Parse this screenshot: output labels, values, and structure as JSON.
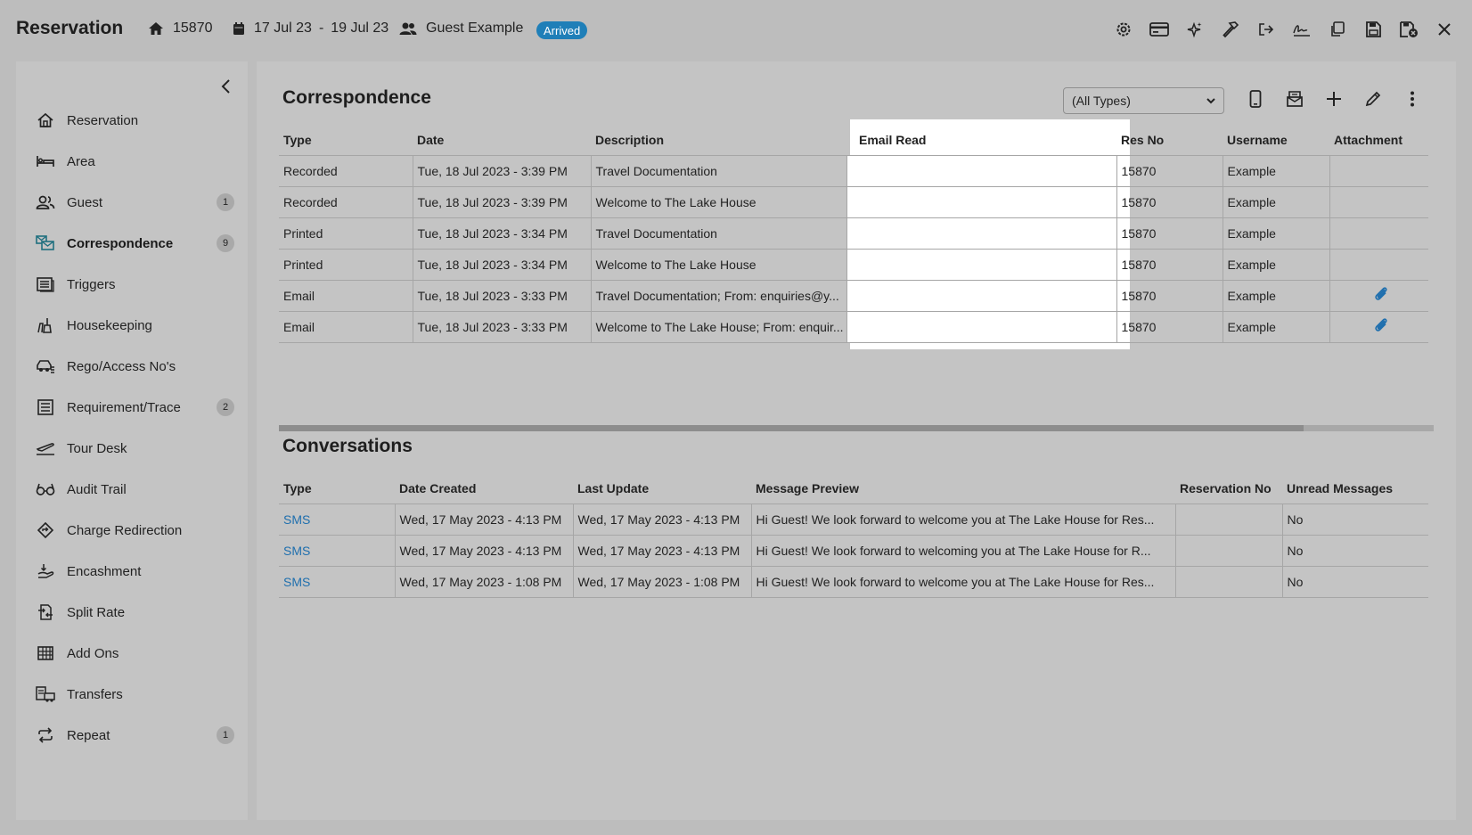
{
  "header": {
    "title": "Reservation",
    "res_no": "15870",
    "date_from": "17 Jul 23",
    "date_sep": "-",
    "date_to": "19 Jul 23",
    "guest": "Guest Example",
    "status": "Arrived",
    "status_color": "#1f7fb8",
    "icons": [
      "gear-icon",
      "card-icon",
      "stars-icon",
      "hammer-icon",
      "checkout-icon",
      "signature-icon",
      "copy-icon",
      "save-icon",
      "save-close-icon",
      "close-icon"
    ]
  },
  "sidebar": {
    "items": [
      {
        "label": "Reservation",
        "icon": "house-icon",
        "count": ""
      },
      {
        "label": "Area",
        "icon": "bed-icon",
        "count": ""
      },
      {
        "label": "Guest",
        "icon": "guest-icon",
        "count": "1"
      },
      {
        "label": "Correspondence",
        "icon": "correspondence-icon",
        "count": "9"
      },
      {
        "label": "Triggers",
        "icon": "triggers-icon",
        "count": ""
      },
      {
        "label": "Housekeeping",
        "icon": "housekeeping-icon",
        "count": ""
      },
      {
        "label": "Rego/Access No's",
        "icon": "car-icon",
        "count": ""
      },
      {
        "label": "Requirement/Trace",
        "icon": "list-icon",
        "count": "2"
      },
      {
        "label": "Tour Desk",
        "icon": "plane-icon",
        "count": ""
      },
      {
        "label": "Audit Trail",
        "icon": "glasses-icon",
        "count": ""
      },
      {
        "label": "Charge Redirection",
        "icon": "redirect-icon",
        "count": ""
      },
      {
        "label": "Encashment",
        "icon": "encash-icon",
        "count": ""
      },
      {
        "label": "Split Rate",
        "icon": "split-icon",
        "count": ""
      },
      {
        "label": "Add Ons",
        "icon": "grid-icon",
        "count": ""
      },
      {
        "label": "Transfers",
        "icon": "bus-icon",
        "count": ""
      },
      {
        "label": "Repeat",
        "icon": "repeat-icon",
        "count": "1"
      }
    ]
  },
  "correspondence": {
    "title": "Correspondence",
    "filter_value": "(All Types)",
    "columns": [
      "Type",
      "Date",
      "Description",
      "Email Read",
      "Res No",
      "Username",
      "Attachment"
    ],
    "rows": [
      {
        "type": "Recorded",
        "date": "Tue, 18 Jul 2023 - 3:39 PM",
        "description": "Travel Documentation",
        "email_read": "",
        "res_no": "15870",
        "username": "Example",
        "attachment": false
      },
      {
        "type": "Recorded",
        "date": "Tue, 18 Jul 2023 - 3:39 PM",
        "description": "Welcome to The Lake House",
        "email_read": "",
        "res_no": "15870",
        "username": "Example",
        "attachment": false
      },
      {
        "type": "Printed",
        "date": "Tue, 18 Jul 2023 - 3:34 PM",
        "description": "Travel Documentation",
        "email_read": "",
        "res_no": "15870",
        "username": "Example",
        "attachment": false
      },
      {
        "type": "Printed",
        "date": "Tue, 18 Jul 2023 - 3:34 PM",
        "description": "Welcome to The Lake House",
        "email_read": "",
        "res_no": "15870",
        "username": "Example",
        "attachment": false
      },
      {
        "type": "Email",
        "date": "Tue, 18 Jul 2023 - 3:33 PM",
        "description": "Travel Documentation; From: enquiries@y...",
        "email_read": "",
        "res_no": "15870",
        "username": "Example",
        "attachment": true
      },
      {
        "type": "Email",
        "date": "Tue, 18 Jul 2023 - 3:33 PM",
        "description": "Welcome to The Lake House; From: enquir...",
        "email_read": "",
        "res_no": "15870",
        "username": "Example",
        "attachment": true
      }
    ]
  },
  "conversations": {
    "title": "Conversations",
    "columns": [
      "Type",
      "Date Created",
      "Last Update",
      "Message Preview",
      "Reservation No",
      "Unread Messages"
    ],
    "rows": [
      {
        "type": "SMS",
        "created": "Wed, 17 May 2023 - 4:13 PM",
        "updated": "Wed, 17 May 2023 - 4:13 PM",
        "preview": "Hi Guest! We look forward to welcome you at The Lake House for Res...",
        "res_no": "",
        "unread": "No"
      },
      {
        "type": "SMS",
        "created": "Wed, 17 May 2023 - 4:13 PM",
        "updated": "Wed, 17 May 2023 - 4:13 PM",
        "preview": "Hi Guest! We look forward to welcoming you at The Lake House for R...",
        "res_no": "",
        "unread": "No"
      },
      {
        "type": "SMS",
        "created": "Wed, 17 May 2023 - 1:08 PM",
        "updated": "Wed, 17 May 2023 - 1:08 PM",
        "preview": "Hi Guest! We look forward to welcome you at The Lake House for Res...",
        "res_no": "",
        "unread": "No"
      }
    ]
  }
}
